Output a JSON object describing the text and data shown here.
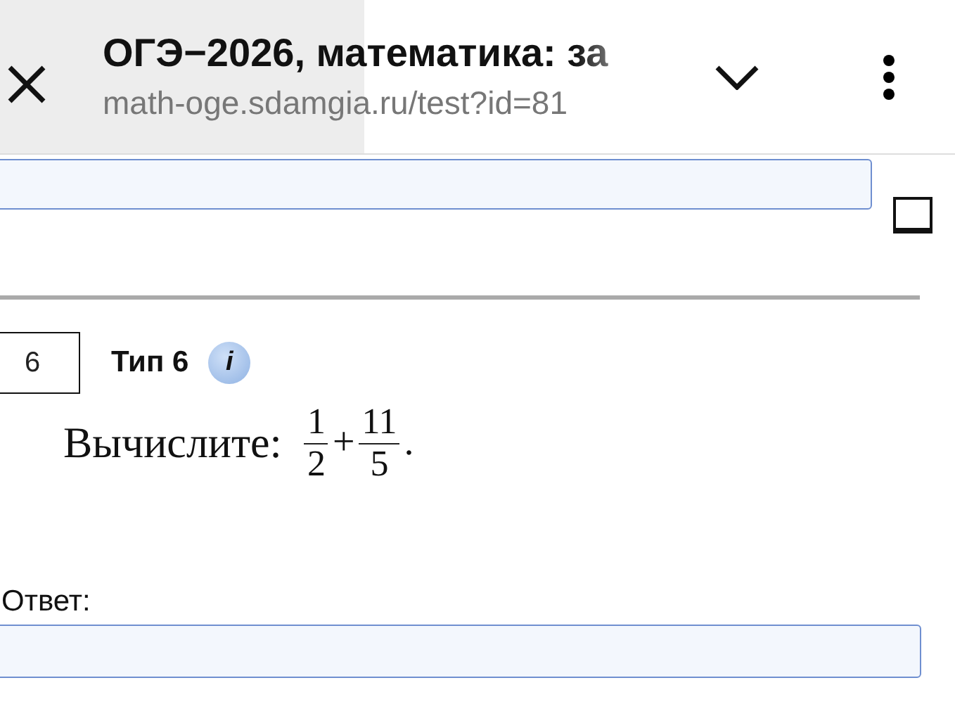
{
  "browser_bar": {
    "title": "ОГЭ−2026, математика: за",
    "url": "math-oge.sdamgia.ru/test?id=81"
  },
  "previous_task": {
    "selected_for_print": false
  },
  "task": {
    "number": "6",
    "type_label": "Тип 6",
    "info_icon": "i",
    "prompt": "Вычислите:",
    "expression": [
      {
        "kind": "fraction",
        "numerator": "1",
        "denominator": "2"
      },
      {
        "kind": "operator",
        "text": "+"
      },
      {
        "kind": "fraction",
        "numerator": "11",
        "denominator": "5"
      },
      {
        "kind": "operator",
        "text": "."
      }
    ],
    "answer_label": "Ответ:"
  }
}
